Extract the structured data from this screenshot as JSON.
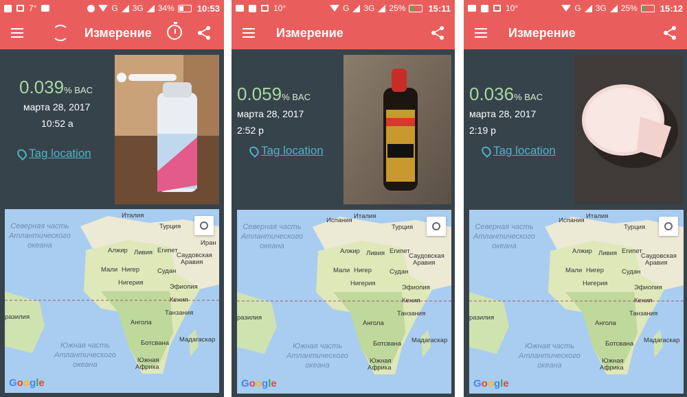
{
  "screens": [
    {
      "status": {
        "icons_left_text": "7°",
        "battery": "34%",
        "network": "G",
        "network2": "3G",
        "clock": "10:53"
      },
      "title": "Измерение",
      "bac_value": "0.039",
      "bac_unit": "% BAC",
      "date": "марта 28, 2017",
      "time": "10:52 a",
      "tag_label": "Tag location"
    },
    {
      "status": {
        "icons_left_text": "10°",
        "battery": "25%",
        "network": "G",
        "network2": "3G",
        "clock": "15:11"
      },
      "title": "Измерение",
      "bac_value": "0.059",
      "bac_unit": "% BAC",
      "date": "марта 28, 2017",
      "time": "2:52 p",
      "tag_label": "Tag location"
    },
    {
      "status": {
        "icons_left_text": "10°",
        "battery": "25%",
        "network": "G",
        "network2": "3G",
        "clock": "15:12"
      },
      "title": "Измерение",
      "bac_value": "0.036",
      "bac_unit": "% BAC",
      "date": "марта 28, 2017",
      "time": "2:19 p",
      "tag_label": "Tag location"
    }
  ],
  "map": {
    "north_atlantic": [
      "Северная часть",
      "Атлантического",
      "океана"
    ],
    "south_atlantic": [
      "Южная часть",
      "Атлантического",
      "океана"
    ],
    "countries": {
      "italy": "Италия",
      "spain": "Испания",
      "turkey": "Турция",
      "iran": "Иран",
      "algeria": "Алжир",
      "libya": "Ливия",
      "egypt": "Египет",
      "saudi1": "Саудовская",
      "saudi2": "Аравия",
      "mali": "Мали",
      "niger": "Нигер",
      "sudan": "Судан",
      "nigeria": "Нигерия",
      "ethiopia": "Эфиопия",
      "kenya": "Кения",
      "brazil": "разилия",
      "tanzania": "Танзания",
      "angola": "Ангола",
      "madagascar": "Мадагаскар",
      "botswana": "Ботсвана",
      "south_africa1": "Южная",
      "south_africa2": "Африка"
    },
    "google": "Google"
  },
  "colors": {
    "accent": "#e95e5c",
    "bac": "#a8d8a0",
    "link": "#4fb3c9",
    "panel": "#37434b"
  }
}
